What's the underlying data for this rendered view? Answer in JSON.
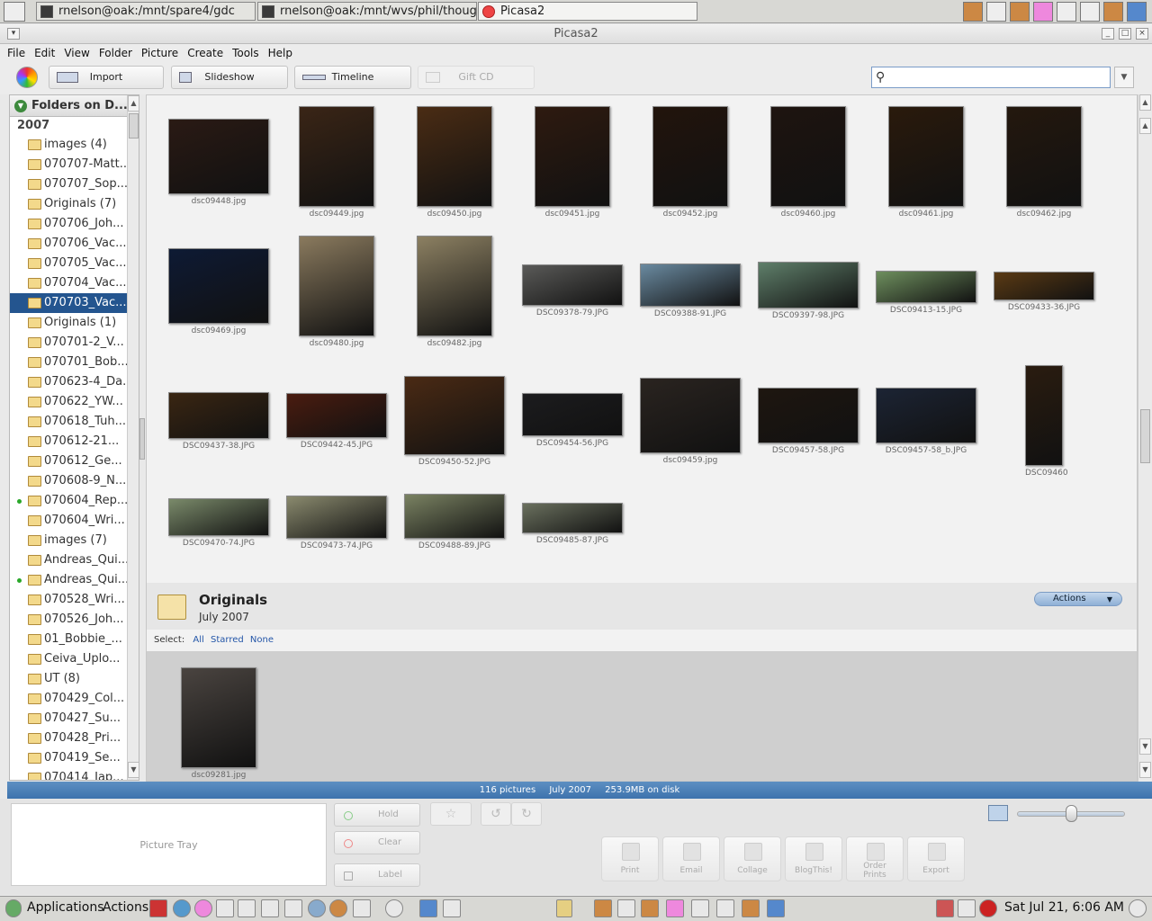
{
  "top_panel": {
    "tasks": [
      {
        "label": "rnelson@oak:/mnt/spare4/gdc"
      },
      {
        "label": "rnelson@oak:/mnt/wvs/phil/thoughtlet"
      },
      {
        "label": "Picasa2"
      }
    ]
  },
  "window": {
    "title": "Picasa2"
  },
  "menu": [
    "File",
    "Edit",
    "View",
    "Folder",
    "Picture",
    "Create",
    "Tools",
    "Help"
  ],
  "toolbar": {
    "import": "Import",
    "slideshow": "Slideshow",
    "timeline": "Timeline",
    "giftcd": "Gift CD",
    "search_value": ""
  },
  "sidebar": {
    "header": "Folders on D...",
    "year": "2007",
    "items": [
      {
        "label": "images (4)",
        "dot": false,
        "selected": false
      },
      {
        "label": "070707-Matt...",
        "dot": false,
        "selected": false
      },
      {
        "label": "070707_Sop...",
        "dot": false,
        "selected": false
      },
      {
        "label": "Originals (7)",
        "dot": false,
        "selected": false
      },
      {
        "label": "070706_Joh...",
        "dot": false,
        "selected": false
      },
      {
        "label": "070706_Vac...",
        "dot": false,
        "selected": false
      },
      {
        "label": "070705_Vac...",
        "dot": false,
        "selected": false
      },
      {
        "label": "070704_Vac...",
        "dot": false,
        "selected": false
      },
      {
        "label": "070703_Vac...",
        "dot": false,
        "selected": true
      },
      {
        "label": "Originals (1)",
        "dot": false,
        "selected": false
      },
      {
        "label": "070701-2_V...",
        "dot": false,
        "selected": false
      },
      {
        "label": "070701_Bob...",
        "dot": false,
        "selected": false
      },
      {
        "label": "070623-4_Da...",
        "dot": false,
        "selected": false
      },
      {
        "label": "070622_YW...",
        "dot": false,
        "selected": false
      },
      {
        "label": "070618_Tuh...",
        "dot": false,
        "selected": false
      },
      {
        "label": "070612-21...",
        "dot": false,
        "selected": false
      },
      {
        "label": "070612_Ge...",
        "dot": false,
        "selected": false
      },
      {
        "label": "070608-9_N...",
        "dot": false,
        "selected": false
      },
      {
        "label": "070604_Rep...",
        "dot": true,
        "selected": false
      },
      {
        "label": "070604_Wri...",
        "dot": false,
        "selected": false
      },
      {
        "label": "images (7)",
        "dot": false,
        "selected": false
      },
      {
        "label": "Andreas_Qui...",
        "dot": false,
        "selected": false
      },
      {
        "label": "Andreas_Qui...",
        "dot": true,
        "selected": false
      },
      {
        "label": "070528_Wri...",
        "dot": false,
        "selected": false
      },
      {
        "label": "070526_Joh...",
        "dot": false,
        "selected": false
      },
      {
        "label": "01_Bobbie_...",
        "dot": false,
        "selected": false
      },
      {
        "label": "Ceiva_Uplo...",
        "dot": false,
        "selected": false
      },
      {
        "label": "UT (8)",
        "dot": false,
        "selected": false
      },
      {
        "label": "070429_Col...",
        "dot": false,
        "selected": false
      },
      {
        "label": "070427_Su...",
        "dot": false,
        "selected": false
      },
      {
        "label": "070428_Pri...",
        "dot": false,
        "selected": false
      },
      {
        "label": "070419_Se...",
        "dot": false,
        "selected": false
      },
      {
        "label": "070414_Jap...",
        "dot": false,
        "selected": false
      }
    ]
  },
  "thumbnails": [
    {
      "name": "dsc09448.jpg",
      "color": "#2a1a14"
    },
    {
      "name": "dsc09449.jpg",
      "color": "#3a2516"
    },
    {
      "name": "dsc09450.jpg",
      "color": "#4a2c14"
    },
    {
      "name": "dsc09451.jpg",
      "color": "#2e1a10"
    },
    {
      "name": "dsc09452.jpg",
      "color": "#22140c"
    },
    {
      "name": "dsc09460.jpg",
      "color": "#1e1410"
    },
    {
      "name": "dsc09461.jpg",
      "color": "#2a1a0c"
    },
    {
      "name": "dsc09462.jpg",
      "color": "#24180e"
    },
    {
      "name": "dsc09469.jpg",
      "color": "#0e1a34"
    },
    {
      "name": "dsc09480.jpg",
      "color": "#8a7a5e"
    },
    {
      "name": "dsc09482.jpg",
      "color": "#8c8062"
    },
    {
      "name": "DSC09378-79.JPG",
      "color": "#5a5a58"
    },
    {
      "name": "DSC09388-91.JPG",
      "color": "#6a8aa0"
    },
    {
      "name": "DSC09397-98.JPG",
      "color": "#5f7f6a"
    },
    {
      "name": "DSC09413-15.JPG",
      "color": "#6e8f5e"
    },
    {
      "name": "DSC09433-36.JPG",
      "color": "#5a3a14"
    },
    {
      "name": "DSC09437-38.JPG",
      "color": "#3a2612"
    },
    {
      "name": "DSC09442-45.JPG",
      "color": "#4a1c10"
    },
    {
      "name": "DSC09450-52.JPG",
      "color": "#4a2a14"
    },
    {
      "name": "DSC09454-56.JPG",
      "color": "#1c1c1e"
    },
    {
      "name": "dsc09459.jpg",
      "color": "#2a2420"
    },
    {
      "name": "DSC09457-58.JPG",
      "color": "#1e1610"
    },
    {
      "name": "DSC09457-58_b.JPG",
      "color": "#1c2434"
    },
    {
      "name": "DSC09460",
      "color": "#2a1c10"
    },
    {
      "name": "DSC09470-74.JPG",
      "color": "#7a8a6a"
    },
    {
      "name": "DSC09473-74.JPG",
      "color": "#8a8a6e"
    },
    {
      "name": "DSC09488-89.JPG",
      "color": "#7a8262"
    },
    {
      "name": "DSC09485-87.JPG",
      "color": "#6a705e"
    },
    {
      "name": "dsc09281.jpg",
      "color": "#4a4440"
    }
  ],
  "album": {
    "title": "Originals",
    "date": "July 2007",
    "actions": "Actions",
    "select_label": "Select:",
    "select_all": "All",
    "select_starred": "Starred",
    "select_none": "None"
  },
  "status": {
    "count": "116 pictures",
    "date": "July 2007",
    "size": "253.9MB on disk"
  },
  "tray": {
    "picture_tray": "Picture Tray",
    "hold": "Hold",
    "clear": "Clear",
    "label": "Label",
    "actions": [
      "Print",
      "Email",
      "Collage",
      "BlogThis!",
      "Order\nPrints",
      "Export"
    ]
  },
  "bottom_panel": {
    "applications": "Applications",
    "actions": "Actions",
    "clock": "Sat Jul 21,  6:06 AM"
  }
}
